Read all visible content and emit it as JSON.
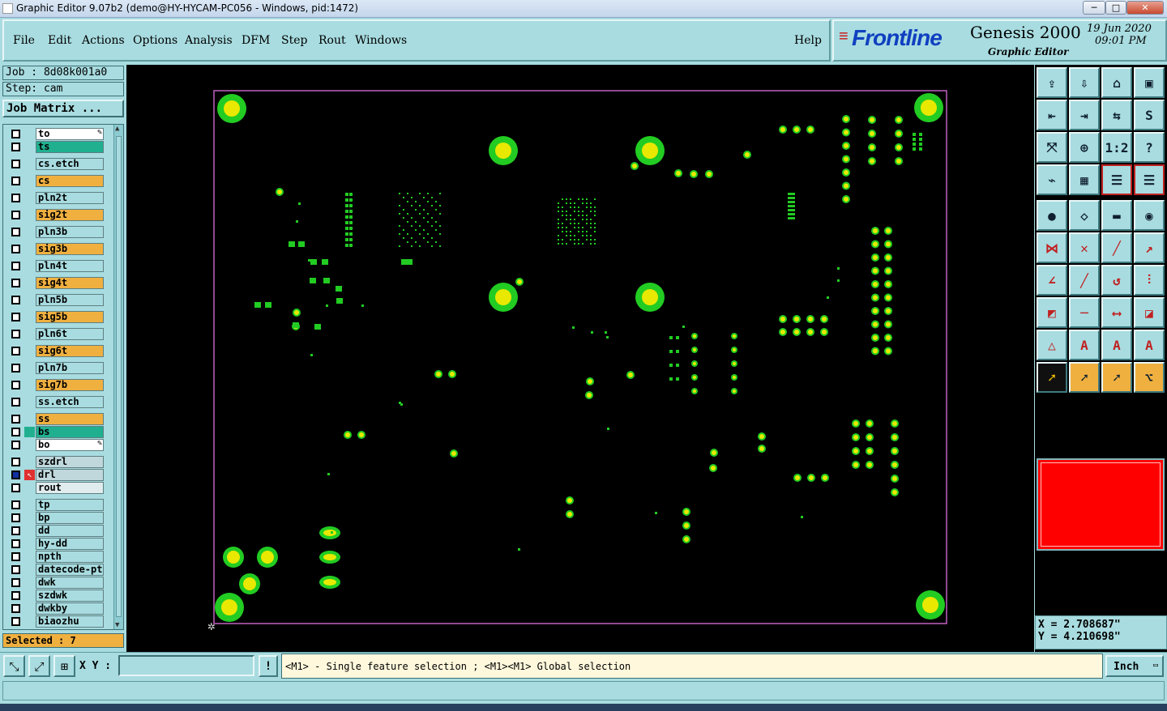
{
  "window": {
    "title": "Graphic Editor 9.07b2 (demo@HY-HYCAM-PC056 - Windows, pid:1472)",
    "min": "─",
    "max": "□",
    "close": "✕"
  },
  "menu": {
    "file": "File",
    "edit": "Edit",
    "actions": "Actions",
    "options": "Options",
    "analysis": "Analysis",
    "dfm": "DFM",
    "step": "Step",
    "rout": "Rout",
    "windows": "Windows",
    "help": "Help"
  },
  "logo": {
    "brand": "Frontline",
    "product": "Genesis 2000",
    "subtitle": "Graphic Editor",
    "date": "19 Jun 2020",
    "time": "09:01 PM"
  },
  "job": {
    "job": "Job : 8d08k001a0",
    "step": "Step: cam",
    "matrix": "Job Matrix ..."
  },
  "layers": [
    {
      "name": "to",
      "color": "#ffffff"
    },
    {
      "name": "ts",
      "color": "#20b090"
    },
    {
      "name": "cs.etch",
      "color": "#a8dce0"
    },
    {
      "name": "cs",
      "color": "#f0b040"
    },
    {
      "name": "pln2t",
      "color": "#a8dce0"
    },
    {
      "name": "sig2t",
      "color": "#f0b040"
    },
    {
      "name": "pln3b",
      "color": "#a8dce0"
    },
    {
      "name": "sig3b",
      "color": "#f0b040"
    },
    {
      "name": "pln4t",
      "color": "#a8dce0"
    },
    {
      "name": "sig4t",
      "color": "#f0b040"
    },
    {
      "name": "pln5b",
      "color": "#a8dce0"
    },
    {
      "name": "sig5b",
      "color": "#f0b040"
    },
    {
      "name": "pln6t",
      "color": "#a8dce0"
    },
    {
      "name": "sig6t",
      "color": "#f0b040"
    },
    {
      "name": "pln7b",
      "color": "#a8dce0"
    },
    {
      "name": "sig7b",
      "color": "#f0b040"
    },
    {
      "name": "ss.etch",
      "color": "#a8dce0"
    },
    {
      "name": "ss",
      "color": "#f0b040"
    },
    {
      "name": "bs",
      "color": "#20b090"
    },
    {
      "name": "bo",
      "color": "#ffffff"
    },
    {
      "name": "szdrl",
      "color": "#c0d8dc"
    },
    {
      "name": "drl",
      "color": "#c0d8dc"
    },
    {
      "name": "rout",
      "color": "#e0ecee"
    },
    {
      "name": "tp",
      "color": "#a8dce0"
    },
    {
      "name": "bp",
      "color": "#a8dce0"
    },
    {
      "name": "dd",
      "color": "#a8dce0"
    },
    {
      "name": "hy-dd",
      "color": "#a8dce0"
    },
    {
      "name": "npth",
      "color": "#a8dce0"
    },
    {
      "name": "datecode-ptc",
      "color": "#a8dce0"
    },
    {
      "name": "dwk",
      "color": "#a8dce0"
    },
    {
      "name": "szdwk",
      "color": "#a8dce0"
    },
    {
      "name": "dwkby",
      "color": "#a8dce0"
    },
    {
      "name": "biaozhu",
      "color": "#a8dce0"
    }
  ],
  "status": {
    "selected": "Selected : 7",
    "xy_label": "X Y :",
    "xy_value": "",
    "hint": "<M1> - Single feature selection ; <M1><M1> Global selection",
    "units": "Inch",
    "warn": "!"
  },
  "coords": {
    "x": "X = 2.708687\"",
    "y": "Y = 4.210698\""
  },
  "colors": {
    "panel": "#a8dce0",
    "board_outline": "#c060c0",
    "pad_green": "#22cc22",
    "pad_yellow": "#e8e800",
    "preview_red": "#ff0000"
  },
  "tools": [
    "export-icon",
    "import-icon",
    "home-icon",
    "window-icon",
    "left-icon",
    "right-icon",
    "swap-icon",
    "s-icon",
    "fit-icon",
    "zoom-icon",
    "scale-1-2",
    "help-icon",
    "measure-icon",
    "grid-icon",
    "layers-red-icon",
    "layers-red2-icon",
    "select-pad-icon",
    "rectangle-icon",
    "ruler-icon",
    "circle-icon",
    "nodes-icon",
    "cross-icon",
    "line-icon",
    "arrow-line-icon",
    "angle-icon",
    "slash-icon",
    "undo-arc-icon",
    "split-icon",
    "box-icon",
    "minus-icon",
    "stretch-icon",
    "shapes-icon",
    "triangle-icon",
    "triangle-a-icon",
    "triangle-a2-icon",
    "triangle-a3-icon",
    "pointer-icon",
    "pointer2-icon",
    "pointer3-icon",
    "route-icon"
  ]
}
